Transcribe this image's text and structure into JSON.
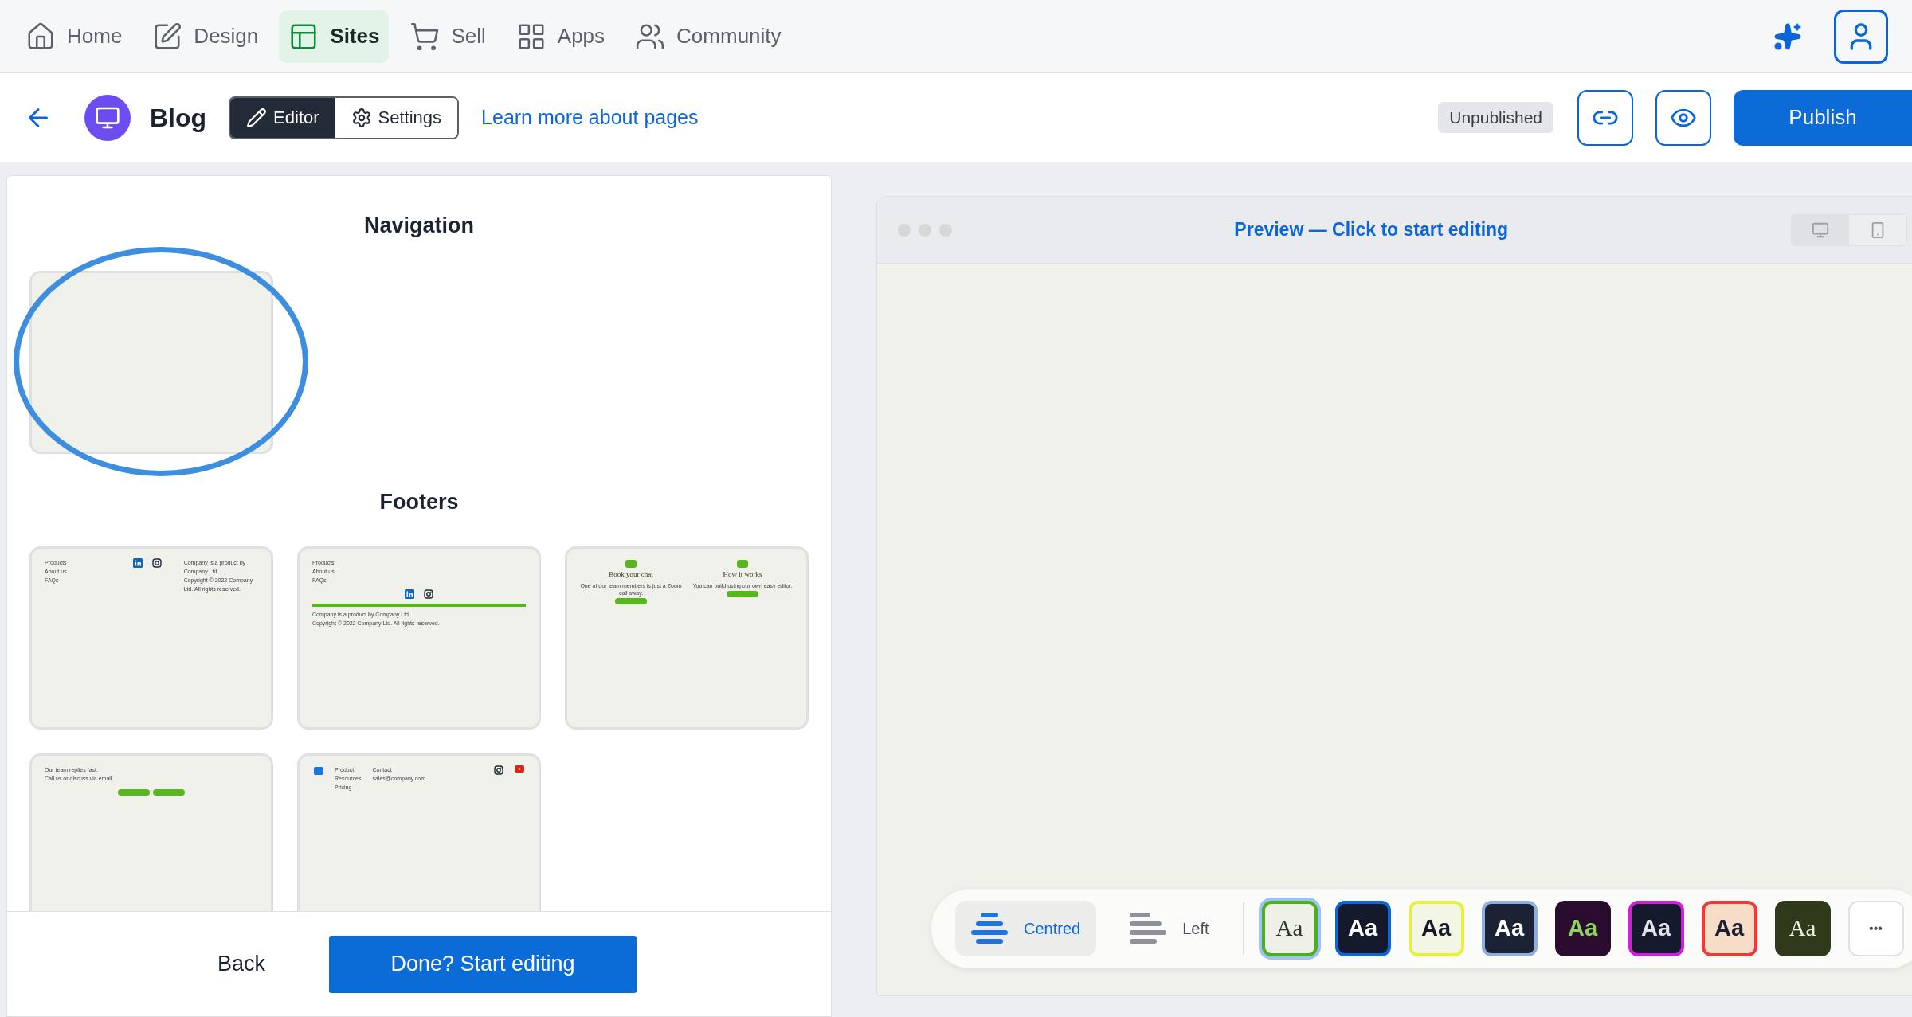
{
  "top_nav": {
    "items": [
      {
        "label": "Home",
        "selected": false
      },
      {
        "label": "Design",
        "selected": false
      },
      {
        "label": "Sites",
        "selected": true
      },
      {
        "label": "Sell",
        "selected": false
      },
      {
        "label": "Apps",
        "selected": false
      },
      {
        "label": "Community",
        "selected": false
      }
    ]
  },
  "page_bar": {
    "title": "Blog",
    "modes": [
      {
        "label": "Editor",
        "selected": true
      },
      {
        "label": "Settings",
        "selected": false
      }
    ],
    "link": "Learn more about pages",
    "status": "Unpublished",
    "publish": "Publish"
  },
  "picker": {
    "sections": [
      {
        "heading": "Navigation",
        "templates": [
          {
            "kind": "blank",
            "highlighted": true
          }
        ]
      },
      {
        "heading": "Footers",
        "templates": [
          {
            "kind": "links_social_legal",
            "links": [
              "Products",
              "About us",
              "FAQs"
            ],
            "legal": [
              "Company is a product by Company Ltd",
              "Copyright © 2022 Company Ltd. All rights reserved."
            ]
          },
          {
            "kind": "stacked",
            "links": [
              "Products",
              "About us",
              "FAQs"
            ],
            "legal": [
              "Company is a product by Company Ltd",
              "Copyright © 2022 Company Ltd. All rights reserved."
            ]
          },
          {
            "kind": "cta_columns",
            "columns": [
              {
                "title": "Book your chat",
                "text": "One of our team members is just a Zoom call away."
              },
              {
                "title": "How it works",
                "text": "You can build using our own easy editor."
              }
            ]
          },
          {
            "kind": "contact_pills",
            "lines": [
              "Our team replies fast.",
              "Call us or discuss via email"
            ]
          },
          {
            "kind": "multi_column",
            "columns": [
              [
                "Product",
                "Resources",
                "Pricing"
              ],
              [
                "Contact",
                "sales@company.com"
              ]
            ]
          }
        ]
      }
    ],
    "back": "Back",
    "done": "Done? Start editing"
  },
  "preview": {
    "title": "Preview — Click to start editing",
    "devices": [
      {
        "selected": true
      },
      {
        "selected": false
      }
    ],
    "alignments": [
      {
        "label": "Centred",
        "selected": true
      },
      {
        "label": "Left",
        "selected": false
      }
    ],
    "themes": [
      {
        "label": "Aa",
        "color": "#eff0e8",
        "ring": {
          "color": "#4caf1e"
        },
        "ink": {
          "color": "#2d3a2a"
        },
        "serif": true,
        "selected": true
      },
      {
        "label": "Aa",
        "color": "#141a2b",
        "ring": {
          "color": "#0b66d8"
        },
        "ink": {
          "color": "#ffffff"
        },
        "serif": false,
        "selected": false
      },
      {
        "label": "Aa",
        "color": "#f3f6e4",
        "ring": {
          "color": "#e4f23a"
        },
        "ink": {
          "color": "#141a2b"
        },
        "serif": false,
        "selected": false
      },
      {
        "label": "Aa",
        "color": "#1a2233",
        "ring": {
          "color": "#8eaee0"
        },
        "ink": {
          "color": "#ffffff"
        },
        "serif": false,
        "selected": false
      },
      {
        "label": "Aa",
        "color": "#2a0d2e",
        "ring": {
          "color": "#2a0d2e"
        },
        "ink": {
          "color": "#8cd35a"
        },
        "serif": false,
        "selected": false
      },
      {
        "label": "Aa",
        "color": "#141a2b",
        "ring": {
          "color": "#d11fd8"
        },
        "ink": {
          "color": "#dfe3ea"
        },
        "serif": false,
        "selected": false
      },
      {
        "label": "Aa",
        "color": "#f7dcc7",
        "ring": {
          "color": "#ef3a3a"
        },
        "ink": {
          "color": "#1d2030"
        },
        "serif": false,
        "selected": false
      },
      {
        "label": "Aa",
        "color": "#2f3a1a",
        "ring": {
          "color": "#2f3a1a"
        },
        "ink": {
          "color": "#eef0e4"
        },
        "serif": true,
        "selected": false
      }
    ],
    "more": "•••"
  }
}
